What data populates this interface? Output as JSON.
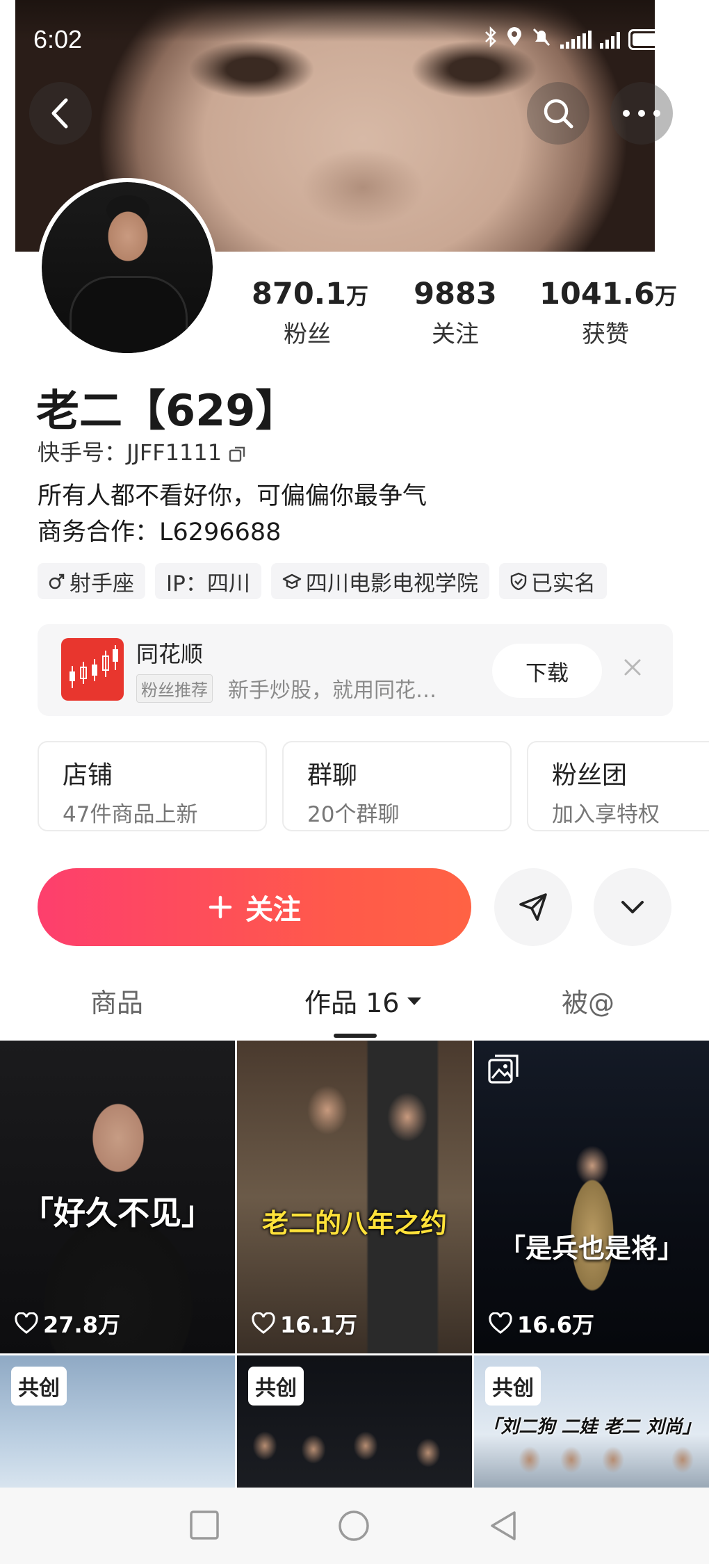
{
  "status_bar": {
    "time": "6:02"
  },
  "profile": {
    "name": "老二【629】",
    "account_label": "快手号：JJFF1111",
    "bio_line1": "所有人都不看好你，可偏偏你最争气",
    "bio_line2": "商务合作：L6296688",
    "stats": [
      {
        "value": "870.1",
        "unit": "万",
        "label": "粉丝"
      },
      {
        "value": "9883",
        "unit": "",
        "label": "关注"
      },
      {
        "value": "1041.6",
        "unit": "万",
        "label": "获赞"
      }
    ],
    "tags": [
      {
        "icon": "male-icon",
        "text": "射手座"
      },
      {
        "icon": "",
        "text": "IP：四川"
      },
      {
        "icon": "graduation-cap-icon",
        "text": "四川电影电视学院"
      },
      {
        "icon": "verified-shield-icon",
        "text": "已实名"
      }
    ]
  },
  "ad": {
    "title": "同花顺",
    "badge": "粉丝推荐",
    "description": "新手炒股，就用同花…",
    "download_label": "下载",
    "brand_color": "#e8362e"
  },
  "shortcuts": [
    {
      "title": "店铺",
      "subtitle": "47件商品上新"
    },
    {
      "title": "群聊",
      "subtitle": "20个群聊"
    },
    {
      "title": "粉丝团",
      "subtitle": "加入享特权"
    }
  ],
  "actions": {
    "follow_label": "关注",
    "follow_gradient": [
      "#fd3f6d",
      "#ff6244"
    ]
  },
  "tabs": [
    {
      "label": "商品"
    },
    {
      "label": "作品 16"
    },
    {
      "label": "被@"
    }
  ],
  "videos": [
    {
      "caption": "「好久不见」",
      "likes": "27.8万"
    },
    {
      "caption": "老二的八年之约",
      "likes": "16.1万"
    },
    {
      "caption": "「是兵也是将」",
      "likes": "16.6万"
    },
    {
      "badge": "共创"
    },
    {
      "badge": "共创"
    },
    {
      "badge": "共创",
      "caption": "「刘二狗 二娃 老二 刘尚」"
    }
  ]
}
